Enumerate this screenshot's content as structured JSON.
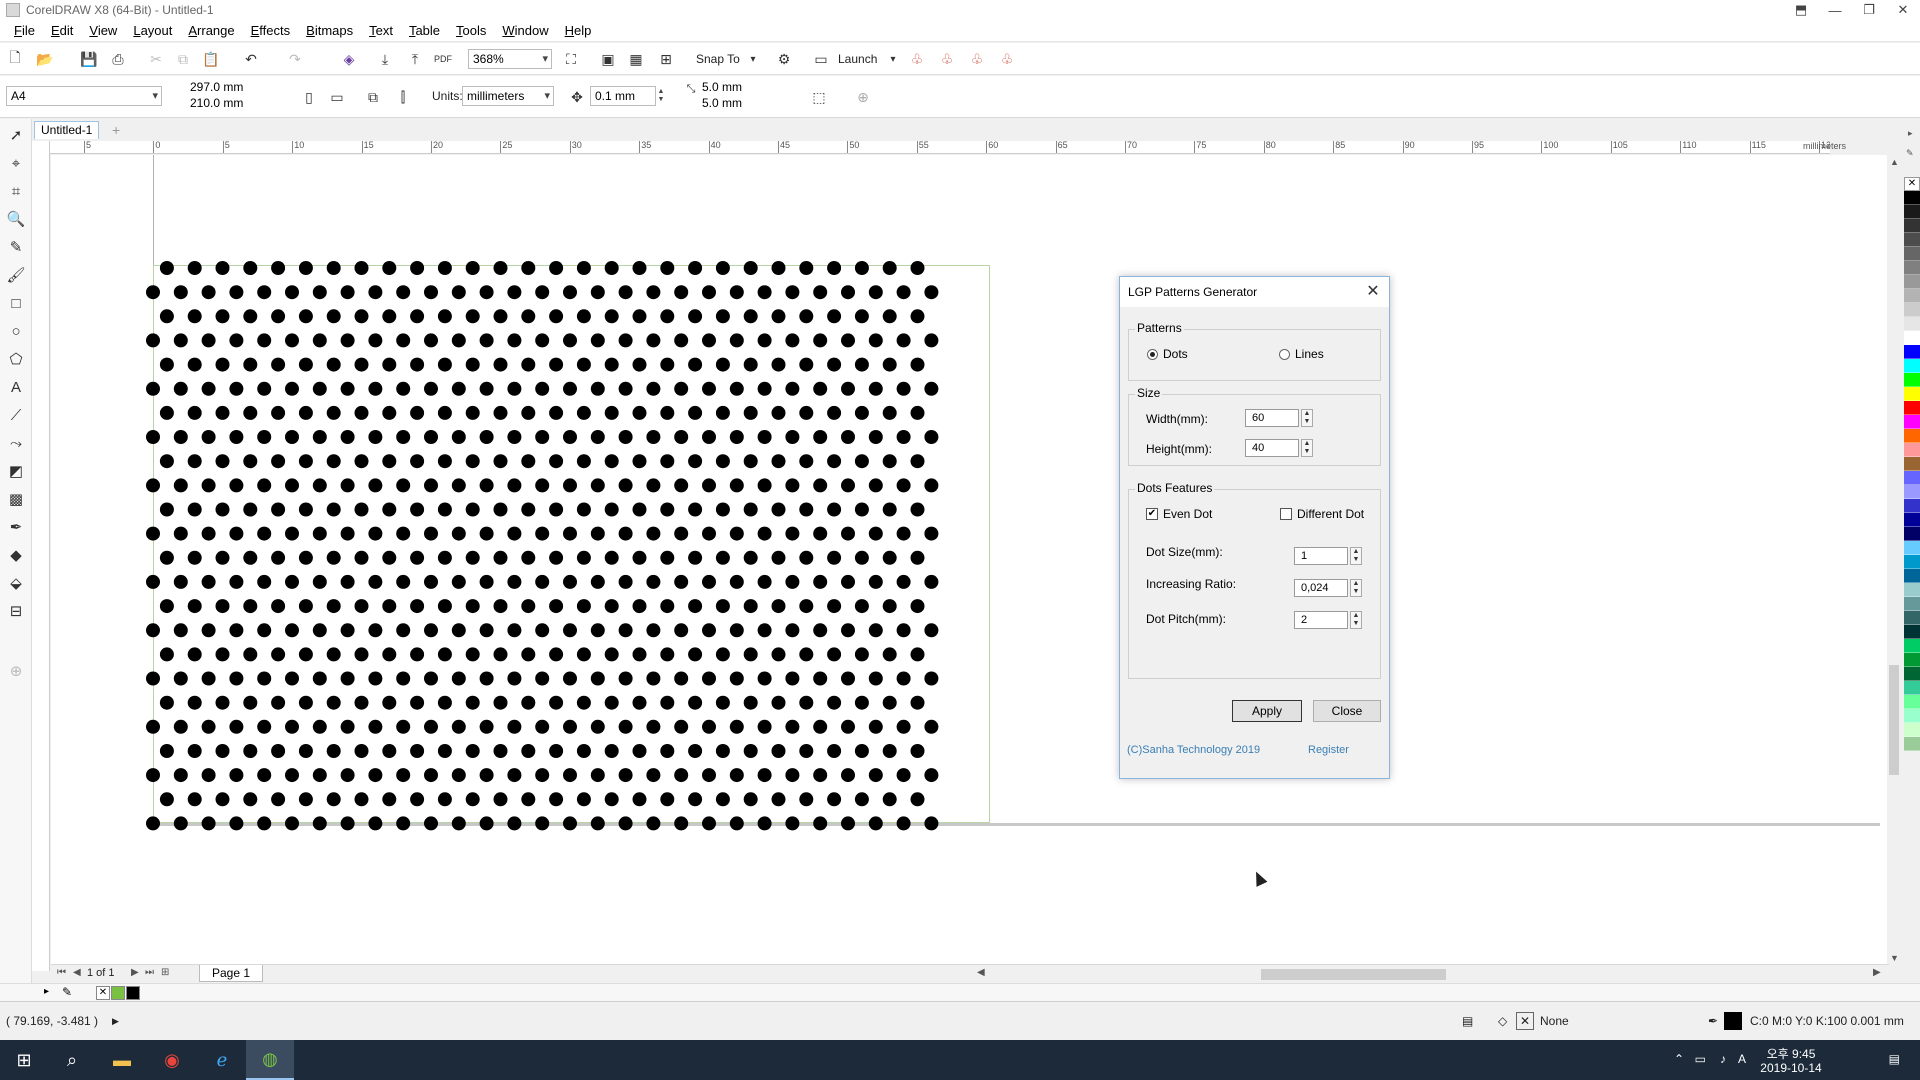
{
  "window": {
    "title": "CorelDRAW X8 (64-Bit) - Untitled-1",
    "controls": [
      "⬒",
      "—",
      "❐",
      "✕"
    ]
  },
  "menu": [
    "File",
    "Edit",
    "View",
    "Layout",
    "Arrange",
    "Effects",
    "Bitmaps",
    "Text",
    "Table",
    "Tools",
    "Window",
    "Help"
  ],
  "toolbar": {
    "zoom": "368%",
    "snap_to": "Snap To",
    "launch": "Launch"
  },
  "property_bar": {
    "page_size": "A4",
    "width": "297.0 mm",
    "height": "210.0 mm",
    "units_label": "Units:",
    "units": "millimeters",
    "nudge": "0.1 mm",
    "dup_x": "5.0 mm",
    "dup_y": "5.0 mm"
  },
  "document": {
    "tab": "Untitled-1",
    "ruler_unit": "millimeters",
    "ruler_ticks": [
      "5",
      "0",
      "5",
      "10",
      "15",
      "20",
      "25",
      "30",
      "35",
      "40",
      "45",
      "50",
      "55",
      "60",
      "65",
      "70",
      "75",
      "80",
      "85",
      "90",
      "95",
      "100",
      "105",
      "110",
      "115",
      "120"
    ],
    "pattern": {
      "rows": 24,
      "cols_even": 28,
      "cols_odd": 29
    }
  },
  "page_nav": {
    "page_count": "1 of 1",
    "page_tab": "Page 1"
  },
  "status": {
    "coords": "( 79.169, -3.481 )",
    "fill": "None",
    "outline": "C:0 M:0 Y:0 K:100  0.001 mm"
  },
  "taskbar": {
    "time": "오후 9:45",
    "date": "2019-10-14",
    "ime": "A"
  },
  "dialog": {
    "title": "LGP Patterns Generator",
    "patterns_label": "Patterns",
    "opt_dots": "Dots",
    "opt_lines": "Lines",
    "size_label": "Size",
    "width_label": "Width(mm):",
    "width_value": "60",
    "height_label": "Height(mm):",
    "height_value": "40",
    "features_label": "Dots Features",
    "even_dot": "Even Dot",
    "different_dot": "Different Dot",
    "dot_size_label": "Dot Size(mm):",
    "dot_size_value": "1",
    "ratio_label": "Increasing Ratio:",
    "ratio_value": "0,024",
    "pitch_label": "Dot Pitch(mm):",
    "pitch_value": "2",
    "apply": "Apply",
    "close": "Close",
    "copyright": "(C)Sanha Technology 2019",
    "register": "Register"
  },
  "palette_colors": [
    "#000000",
    "#1a1a1a",
    "#333333",
    "#4d4d4d",
    "#666666",
    "#808080",
    "#999999",
    "#b3b3b3",
    "#cccccc",
    "#e6e6e6",
    "#ffffff",
    "#0000ff",
    "#00ffff",
    "#00ff00",
    "#ffff00",
    "#ff0000",
    "#ff00ff",
    "#ff6600",
    "#ff9999",
    "#996633",
    "#6666ff",
    "#9999ff",
    "#3333cc",
    "#000099",
    "#000066",
    "#66ccff",
    "#0099cc",
    "#006699",
    "#99cccc",
    "#669999",
    "#336666",
    "#003333",
    "#00cc66",
    "#009933",
    "#006633",
    "#33cc99",
    "#66ff99",
    "#99ffcc",
    "#ccffcc",
    "#99cc99"
  ]
}
